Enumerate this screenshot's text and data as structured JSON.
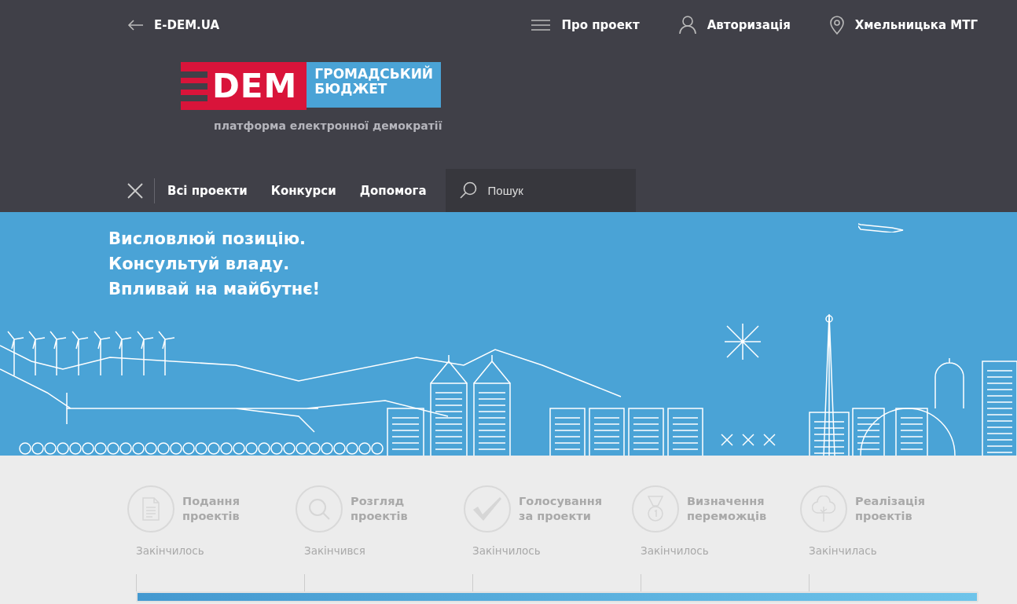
{
  "top_bar": {
    "back_link": "E-DEM.UA",
    "links": [
      {
        "kind": "menu",
        "label": "Про проект"
      },
      {
        "kind": "user",
        "label": "Авторизація"
      },
      {
        "kind": "location",
        "label": "Хмельницька МТГ"
      }
    ]
  },
  "logo": {
    "mark": "DEM",
    "title_lines": [
      "ГРОМАДСЬКИЙ",
      "БЮДЖЕТ"
    ],
    "tagline": "платформа електронної демократії"
  },
  "nav": {
    "items": [
      "Всі проекти",
      "Конкурси",
      "Допомога"
    ],
    "search": {
      "placeholder": "Пошук"
    }
  },
  "hero": {
    "lines": [
      "Висловлюй позицію.",
      "Консультуй владу.",
      "Впливай на майбутнє!"
    ]
  },
  "stages": [
    {
      "kind": "document",
      "title_lines": [
        "Подання",
        "проектів"
      ],
      "status": "Закінчилось"
    },
    {
      "kind": "search",
      "title_lines": [
        "Розгляд",
        "проектів"
      ],
      "status": "Закінчився"
    },
    {
      "kind": "check",
      "title_lines": [
        "Голосування",
        "за проекти"
      ],
      "status": "Закінчилось"
    },
    {
      "kind": "medal",
      "title_lines": [
        "Визначення",
        "переможців"
      ],
      "status": "Закінчилось"
    },
    {
      "kind": "tree",
      "title_lines": [
        "Реалізація",
        "проектів"
      ],
      "status": "Закінчилась"
    }
  ],
  "progress": {
    "level": 1
  }
}
